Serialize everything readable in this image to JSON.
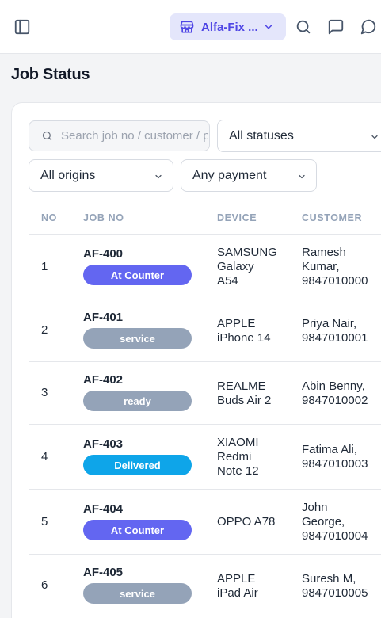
{
  "header": {
    "store_name": "Alfa-Fix ...",
    "icons": [
      "sidebar-toggle-icon",
      "store-icon",
      "search-icon",
      "message-square-icon",
      "message-circle-icon"
    ]
  },
  "page": {
    "title": "Job Status"
  },
  "filters": {
    "search_placeholder": "Search job no / customer / phone",
    "status": "All statuses",
    "origin": "All origins",
    "payment": "Any payment"
  },
  "table": {
    "headers": {
      "no": "NO",
      "job_no": "JOB NO",
      "device": "DEVICE",
      "customer": "CUSTOMER"
    },
    "rows": [
      {
        "no": "1",
        "job_no": "AF-400",
        "status": "At Counter",
        "device": [
          "SAMSUNG",
          "Galaxy",
          "A54"
        ],
        "customer": [
          "Ramesh",
          "Kumar,",
          "9847010000"
        ]
      },
      {
        "no": "2",
        "job_no": "AF-401",
        "status": "service",
        "device": [
          "APPLE",
          "iPhone 14"
        ],
        "customer": [
          "Priya Nair,",
          "9847010001"
        ]
      },
      {
        "no": "3",
        "job_no": "AF-402",
        "status": "ready",
        "device": [
          "REALME",
          "Buds Air 2"
        ],
        "customer": [
          "Abin Benny,",
          "9847010002"
        ]
      },
      {
        "no": "4",
        "job_no": "AF-403",
        "status": "Delivered",
        "device": [
          "XIAOMI",
          "Redmi",
          "Note 12"
        ],
        "customer": [
          "Fatima Ali,",
          "9847010003"
        ]
      },
      {
        "no": "5",
        "job_no": "AF-404",
        "status": "At Counter",
        "device": [
          "OPPO A78"
        ],
        "customer": [
          "John",
          "George,",
          "9847010004"
        ]
      },
      {
        "no": "6",
        "job_no": "AF-405",
        "status": "service",
        "device": [
          "APPLE",
          "iPad Air"
        ],
        "customer": [
          "Suresh M,",
          "9847010005"
        ]
      }
    ]
  },
  "colors": {
    "accent": "#4f46e5",
    "status_at_counter": "#6366f1",
    "status_service": "#94a3b8",
    "status_ready": "#94a3b8",
    "status_delivered": "#0ea5e9"
  }
}
